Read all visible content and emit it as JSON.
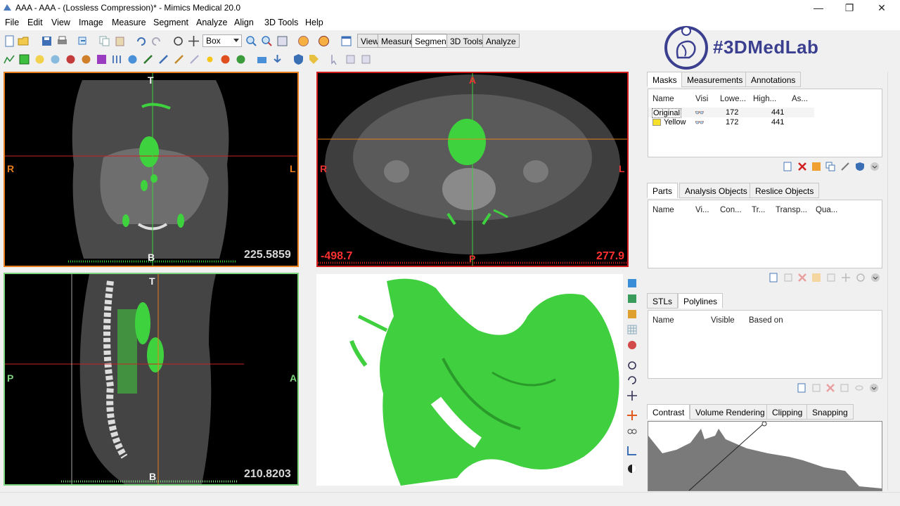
{
  "window": {
    "title": "AAA - AAA -  (Lossless Compression)* - Mimics Medical 20.0",
    "minimize": "—",
    "maximize": "❐",
    "close": "✕"
  },
  "menu": [
    "File",
    "Edit",
    "View",
    "Image",
    "Measure",
    "Segment",
    "Analyze",
    "Align",
    "3D Tools",
    "Help"
  ],
  "toolbar": {
    "select_value": "Box",
    "mode_tabs": [
      "View",
      "Measure",
      "Segment",
      "3D Tools",
      "Analyze"
    ],
    "active_mode": "Segment"
  },
  "brand": {
    "text": "#3DMedLab",
    "color": "#3a3f8f"
  },
  "views": {
    "coronal": {
      "top": "T",
      "bottom": "B",
      "left": "R",
      "right": "L",
      "value": "225.5859"
    },
    "axial": {
      "top": "A",
      "bottom": "P",
      "left": "R",
      "right": "L",
      "window_low": "-498.7",
      "window_high": "277.9"
    },
    "sagittal": {
      "top": "T",
      "bottom": "B",
      "left": "P",
      "right": "A",
      "value": "210.8203"
    }
  },
  "masks_panel": {
    "tabs": [
      "Masks",
      "Measurements",
      "Annotations"
    ],
    "columns": [
      "Name",
      "Visi",
      "Lowe...",
      "High...",
      "As..."
    ],
    "rows": [
      {
        "name": "Original",
        "lower": "172",
        "higher": "441"
      },
      {
        "name": "Yellow",
        "lower": "172",
        "higher": "441"
      }
    ]
  },
  "parts_panel": {
    "tabs": [
      "Parts",
      "Analysis Objects",
      "Reslice Objects"
    ],
    "columns": [
      "Name",
      "Vi...",
      "Con...",
      "Tr...",
      "Transp...",
      "Qua..."
    ]
  },
  "polylines_panel": {
    "tabs": [
      "STLs",
      "Polylines"
    ],
    "columns": [
      "Name",
      "Visible",
      "Based on"
    ]
  },
  "bottom_panel": {
    "tabs": [
      "Contrast",
      "Volume Rendering",
      "Clipping",
      "Snapping"
    ]
  },
  "colors": {
    "segment_green": "#3fd23f",
    "coronal_border": "#e87e1e",
    "axial_border": "#d11d1d",
    "sagittal_border": "#7ed37e"
  }
}
